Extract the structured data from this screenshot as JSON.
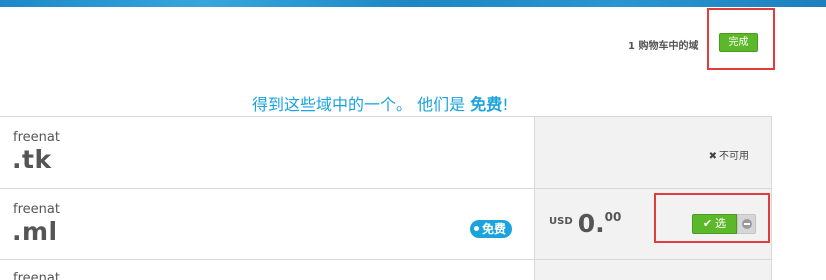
{
  "cart": {
    "count_text": "1 购物车中的域",
    "done_label": "完成"
  },
  "promo": {
    "text": "得到这些域中的一个。 他们是 ",
    "free_word": "免费",
    "suffix": "!"
  },
  "domains": [
    {
      "name": "freenat",
      "tld": ".tk",
      "status": "unavailable",
      "status_icon": "x-icon",
      "status_text": "不可用"
    },
    {
      "name": "freenat",
      "tld": ".ml",
      "status": "available",
      "badge": "免费",
      "currency": "USD",
      "price_int": "0.",
      "price_dec": "00",
      "select_label": "选",
      "select_icon": "check-icon",
      "remove_icon": "minus-circle-icon"
    },
    {
      "name": "freenat"
    }
  ],
  "colors": {
    "accent_blue": "#1aa3dc",
    "green_button": "#5cb82a",
    "highlight_red": "#e23b3b"
  }
}
